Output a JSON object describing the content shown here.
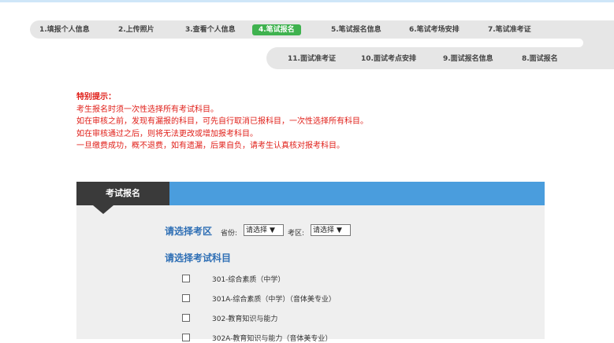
{
  "steps": {
    "s1": "1.填报个人信息",
    "s2": "2.上传照片",
    "s3": "3.查看个人信息",
    "s4": "4.笔试报名",
    "s5": "5.笔试报名信息",
    "s6": "6.笔试考场安排",
    "s7": "7.笔试准考证",
    "s8": "8.面试报名",
    "s9": "9.面试报名信息",
    "s10": "10.面试考点安排",
    "s11": "11.面试准考证"
  },
  "notice": {
    "title": "特别提示：",
    "line1": "考生报名时须一次性选择所有考试科目。",
    "line2": "如在审核之前，发现有漏报的科目，可先自行取消已报科目，一次性选择所有科目。",
    "line3": "如在审核通过之后，则将无法更改或增加报考科目。",
    "line4": "一旦缴费成功，概不退费，如有遗漏，后果自负，请考生认真核对报考科目。"
  },
  "panel": {
    "tab_label": "考试报名",
    "region_title": "请选择考区",
    "province_label": "省份:",
    "province_value": "请选择",
    "district_label": "考区:",
    "district_value": "请选择",
    "subject_title": "请选择考试科目"
  },
  "subjects": [
    "301-综合素质（中学）",
    "301A-综合素质（中学）（音体美专业）",
    "302-教育知识与能力",
    "302A-教育知识与能力（音体美专业）"
  ],
  "colors": {
    "active_step": "#3fb24f",
    "panel_bar": "#4a9ddd",
    "panel_tab": "#3a3a3a",
    "notice": "#e0201a",
    "section_title": "#2f6fb5"
  }
}
